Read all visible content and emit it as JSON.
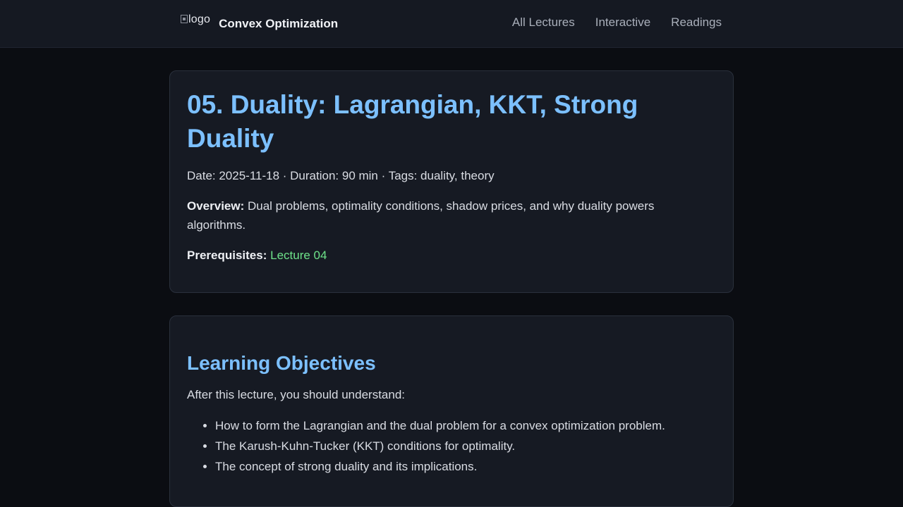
{
  "header": {
    "logo_alt": "logo",
    "brand": "Convex Optimization",
    "nav": [
      {
        "label": "All Lectures"
      },
      {
        "label": "Interactive"
      },
      {
        "label": "Readings"
      }
    ]
  },
  "lecture": {
    "title": "05. Duality: Lagrangian, KKT, Strong Duality",
    "meta": "Date: 2025-11-18 · Duration: 90 min · Tags: duality, theory",
    "overview_label": "Overview:",
    "overview_text": " Dual problems, optimality conditions, shadow prices, and why duality powers algorithms.",
    "prereq_label": "Prerequisites:",
    "prereq_link": "Lecture 04"
  },
  "objectives": {
    "heading": "Learning Objectives",
    "intro": "After this lecture, you should understand:",
    "items": [
      "How to form the Lagrangian and the dual problem for a convex optimization problem.",
      "The Karush-Kuhn-Tucker (KKT) conditions for optimality.",
      "The concept of strong duality and its implications."
    ]
  },
  "colors": {
    "background": "#0b0d12",
    "header_bg": "#151922",
    "card_bg": "#161a23",
    "heading": "#7cc0ff",
    "link": "#6ee28a"
  }
}
